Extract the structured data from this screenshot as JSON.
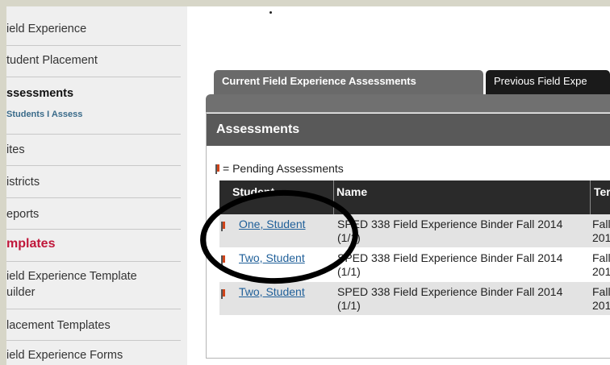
{
  "sidebar": {
    "items": [
      {
        "label": "ield Experience"
      },
      {
        "label": "tudent Placement"
      },
      {
        "label": "ssessments"
      },
      {
        "label": "Students I Assess"
      },
      {
        "label": "ites"
      },
      {
        "label": "istricts"
      },
      {
        "label": "eports"
      },
      {
        "label": "mplates"
      },
      {
        "label": "ield Experience Template"
      },
      {
        "label": "uilder"
      },
      {
        "label": "lacement Templates"
      },
      {
        "label": "ield Experience Forms"
      }
    ]
  },
  "tabs": [
    {
      "label": "Current Field Experience Assessments"
    },
    {
      "label": "Previous Field Expe"
    }
  ],
  "panel": {
    "title": "Assessments",
    "legend": "= Pending Assessments"
  },
  "table": {
    "headers": [
      "Student",
      "Name",
      "Ter"
    ],
    "rows": [
      {
        "student": "One, Student",
        "name": "SPED 338 Field Experience Binder Fall 2014 (1/1)",
        "term": "Fall 201"
      },
      {
        "student": "Two, Student",
        "name": "SPED 338 Field Experience Binder Fall 2014 (1/1)",
        "term": "Fall 201"
      },
      {
        "student": "Two, Student",
        "name": "SPED 338 Field Experience Binder Fall 2014 (1/1)",
        "term": "Fall 201"
      }
    ]
  },
  "colors": {
    "background": "#d7d6c8",
    "sidebar_bg": "#efefef",
    "active_red": "#c0173a",
    "link_blue": "#1f5f99",
    "header_dark": "#2a2a2a",
    "pending_flag": "#d0451b"
  },
  "icons": [
    "pending-flag-icon"
  ]
}
